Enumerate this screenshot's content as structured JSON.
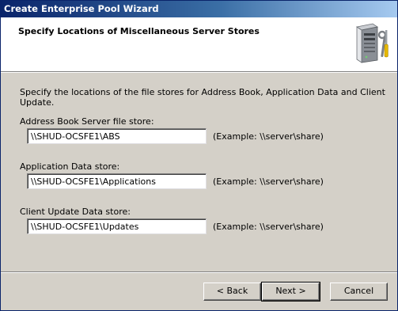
{
  "window": {
    "title": "Create Enterprise Pool Wizard"
  },
  "header": {
    "title": "Specify Locations of Miscellaneous Server Stores",
    "icon": "server-tools-icon"
  },
  "intro": "Specify the locations of the file stores for Address Book, Application Data and Client Update.",
  "fields": [
    {
      "label": "Address Book Server file store:",
      "value": "\\\\SHUD-OCSFE1\\ABS",
      "example": "(Example: \\\\server\\share)"
    },
    {
      "label": "Application Data store:",
      "value": "\\\\SHUD-OCSFE1\\Applications",
      "example": "(Example: \\\\server\\share)"
    },
    {
      "label": "Client Update Data store:",
      "value": "\\\\SHUD-OCSFE1\\Updates",
      "example": "(Example: \\\\server\\share)"
    }
  ],
  "buttons": {
    "back": "< Back",
    "next": "Next >",
    "cancel": "Cancel"
  },
  "colors": {
    "titlebar_start": "#0a246a",
    "titlebar_end": "#a6caf0",
    "dialog_bg": "#d4d0c8",
    "header_bg": "#ffffff"
  }
}
